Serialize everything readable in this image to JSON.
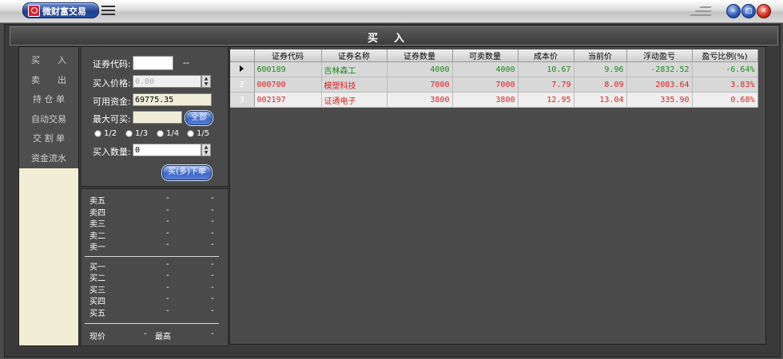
{
  "app": {
    "title": "微财富交易"
  },
  "page": {
    "title": "买入"
  },
  "nav": {
    "items": [
      {
        "label": "买　　入"
      },
      {
        "label": "卖　　出"
      },
      {
        "label": "持 仓 单"
      },
      {
        "label": "自动交易"
      },
      {
        "label": "交 割 单"
      },
      {
        "label": "资金流水"
      }
    ]
  },
  "form": {
    "code_label": "证券代码:",
    "code_value": "",
    "code_name": "--",
    "price_label": "买入价格:",
    "price_value": "0.00",
    "funds_label": "可用资金:",
    "funds_value": "69775.35",
    "maxbuy_label": "最大可买:",
    "maxbuy_value": "",
    "all_button": "全部",
    "fractions": [
      "1/2",
      "1/3",
      "1/4",
      "1/5"
    ],
    "qty_label": "买入数量:",
    "qty_value": "0",
    "submit_button": "买(多)下单"
  },
  "depth": {
    "sell": [
      {
        "label": "卖五",
        "price": "-",
        "vol": "-"
      },
      {
        "label": "卖四",
        "price": "-",
        "vol": "-"
      },
      {
        "label": "卖三",
        "price": "-",
        "vol": "-"
      },
      {
        "label": "卖二",
        "price": "-",
        "vol": "-"
      },
      {
        "label": "卖一",
        "price": "-",
        "vol": "-"
      }
    ],
    "buy": [
      {
        "label": "买一",
        "price": "-",
        "vol": "-"
      },
      {
        "label": "买二",
        "price": "-",
        "vol": "-"
      },
      {
        "label": "买三",
        "price": "-",
        "vol": "-"
      },
      {
        "label": "买四",
        "price": "-",
        "vol": "-"
      },
      {
        "label": "买五",
        "price": "-",
        "vol": "-"
      }
    ],
    "current_label": "现价",
    "current_value": "-",
    "high_label": "最高",
    "high_value": "-"
  },
  "holdings": {
    "columns": [
      "证券代码",
      "证券名称",
      "证券数量",
      "可卖数量",
      "成本价",
      "当前价",
      "浮动盈亏",
      "盈亏比例(%)"
    ],
    "rows": [
      {
        "idx": "",
        "code": "600189",
        "name": "吉林森工",
        "qty": "4000",
        "avail": "4000",
        "cost": "10.67",
        "price": "9.96",
        "pnl": "-2832.52",
        "pct": "-6.64%"
      },
      {
        "idx": "2",
        "code": "000700",
        "name": "模塑科技",
        "qty": "7000",
        "avail": "7000",
        "cost": "7.79",
        "price": "8.09",
        "pnl": "2083.64",
        "pct": "3.83%"
      },
      {
        "idx": "3",
        "code": "002197",
        "name": "证通电子",
        "qty": "3800",
        "avail": "3800",
        "cost": "12.95",
        "price": "13.04",
        "pnl": "335.90",
        "pct": "0.68%"
      }
    ]
  }
}
